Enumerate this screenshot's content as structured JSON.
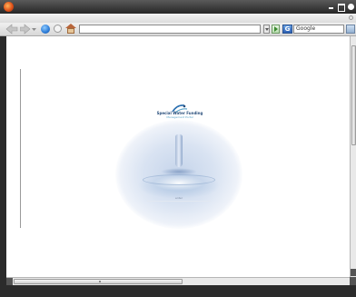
{
  "window": {
    "title": ""
  },
  "toolbar": {
    "back_icon": "arrow-left-icon",
    "forward_icon": "arrow-right-icon",
    "reload_icon": "reload-icon",
    "stop_icon": "stop-icon",
    "home_icon": "home-icon",
    "url_value": "",
    "go_icon": "go-arrow-icon"
  },
  "search": {
    "engine_icon": "google-icon",
    "engine_letter": "G",
    "placeholder": "Google"
  },
  "page": {
    "logo_text": "Special Water Funding",
    "logo_subtext": "Management Portal",
    "enter_text": "enter",
    "footer_text": ""
  },
  "colors": {
    "titlebar": "#262626",
    "chrome": "#dcdcdc",
    "content_bg": "#ffffff",
    "logo_blue": "#2a4f7c",
    "logo_accent": "#5aa4c9"
  }
}
